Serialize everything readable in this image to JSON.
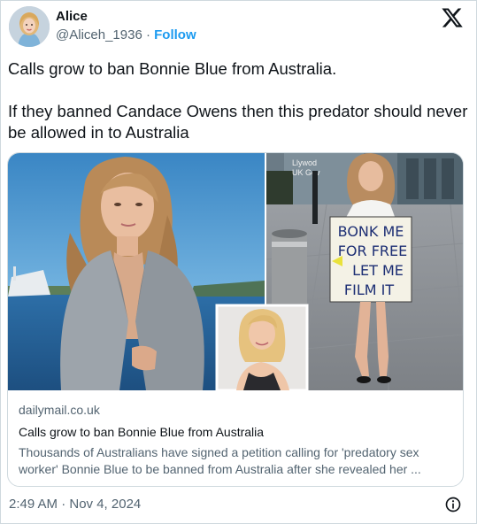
{
  "author": {
    "name": "Alice",
    "handle": "@Aliceh_1936",
    "separator": "·",
    "follow_label": "Follow"
  },
  "tweet": {
    "line1": "Calls grow to ban Bonnie Blue from Australia.",
    "line2": "If they banned Candace Owens then this predator should never be allowed in to Australia"
  },
  "card": {
    "domain": "dailymail.co.uk",
    "title": "Calls grow to ban Bonnie Blue from Australia",
    "description": "Thousands of Australians have signed a petition calling for 'predatory sex worker' Bonnie Blue to be banned from Australia after she revealed her ...",
    "sign_text": [
      "BONK ME",
      "FOR FREE",
      "LET ME",
      "FILM IT"
    ],
    "background_sign_text": [
      "Llywod",
      "UK Gov"
    ]
  },
  "footer": {
    "timestamp": "2:49 AM · Nov 4, 2024"
  },
  "icons": {
    "platform": "x-logo-icon",
    "info": "info-icon"
  },
  "colors": {
    "link": "#1d9bf0",
    "secondary_text": "#536471",
    "border": "#cfd9de"
  }
}
